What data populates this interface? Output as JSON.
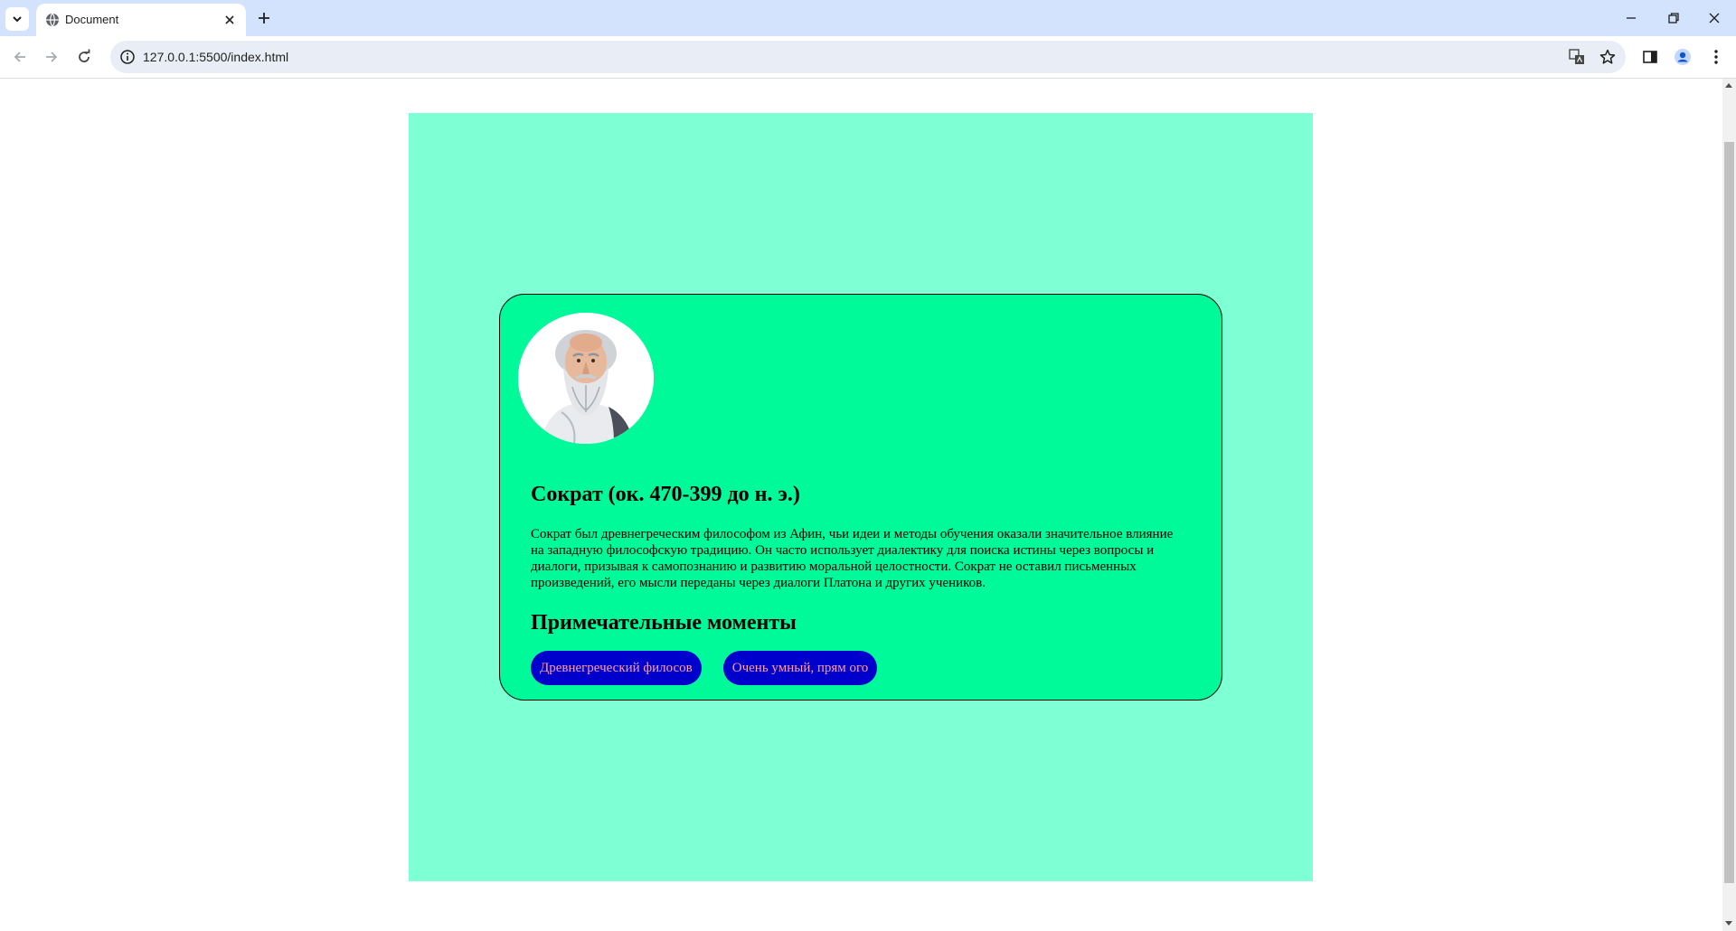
{
  "browser": {
    "tab_title": "Document",
    "url": "127.0.0.1:5500/index.html"
  },
  "colors": {
    "page_background": "#7fffd4",
    "card_background": "#00fa9a",
    "tag_background": "#0000cd",
    "tag_text": "#ff9ea8"
  },
  "card": {
    "title": "Сократ (ок. 470-399 до н. э.)",
    "bio": "Сократ был древнегреческим философом из Афин, чьи идеи и методы обучения оказали значительное влияние на западную философскую традицию. Он часто использует диалектику для поиска истины через вопросы и диалоги, призывая к самопознанию и развитию моральной целостности. Сократ не оставил письменных произведений, его мысли переданы через диалоги Платона и других учеников.",
    "highlights_heading": "Примечательные моменты",
    "tags": [
      "Древнегреческий филосов",
      "Очень умный, прям ого"
    ]
  }
}
